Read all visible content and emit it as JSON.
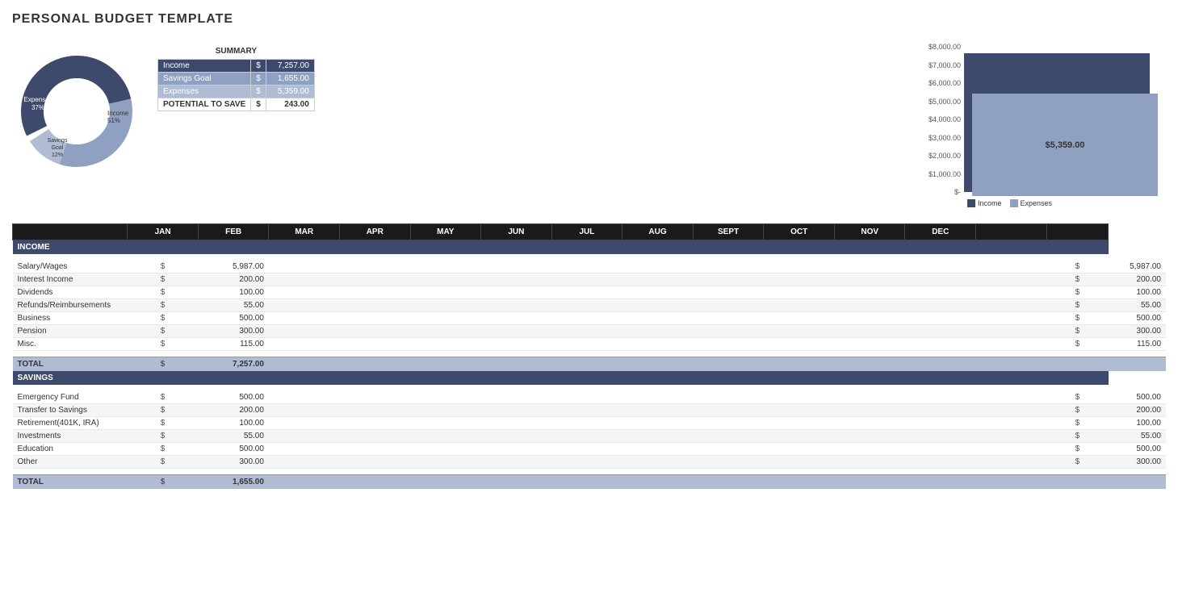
{
  "title": "PERSONAL BUDGET TEMPLATE",
  "summary": {
    "title": "SUMMARY",
    "rows": [
      {
        "label": "Income",
        "dollar": "$",
        "value": "7,257.00",
        "type": "income"
      },
      {
        "label": "Savings Goal",
        "dollar": "$",
        "value": "1,655.00",
        "type": "savings"
      },
      {
        "label": "Expenses",
        "dollar": "$",
        "value": "5,359.00",
        "type": "expenses"
      }
    ],
    "potential_label": "POTENTIAL TO SAVE",
    "potential_dollar": "$",
    "potential_value": "243.00"
  },
  "donut": {
    "income_pct": "51%",
    "income_label": "Income",
    "savings_pct": "12%",
    "savings_label": "Savings Goal",
    "expenses_pct": "37%",
    "expenses_label": "Expenses"
  },
  "chart": {
    "y_labels": [
      "$8,000.00",
      "$7,000.00",
      "$6,000.00",
      "$5,000.00",
      "$4,000.00",
      "$3,000.00",
      "$2,000.00",
      "$1,000.00",
      "$-"
    ],
    "income_value": "$7,257.00",
    "expenses_value": "$5,359.00",
    "legend_income": "Income",
    "legend_expenses": "Expenses"
  },
  "months": [
    "JAN",
    "FEB",
    "MAR",
    "APR",
    "MAY",
    "JUN",
    "JUL",
    "AUG",
    "SEPT",
    "OCT",
    "NOV",
    "DEC"
  ],
  "income": {
    "section_label": "INCOME",
    "rows": [
      {
        "label": "Salary/Wages",
        "dollar": "$",
        "jan": "5,987.00",
        "annual_dollar": "$",
        "annual": "5,987.00"
      },
      {
        "label": "Interest Income",
        "dollar": "$",
        "jan": "200.00",
        "annual_dollar": "$",
        "annual": "200.00"
      },
      {
        "label": "Dividends",
        "dollar": "$",
        "jan": "100.00",
        "annual_dollar": "$",
        "annual": "100.00"
      },
      {
        "label": "Refunds/Reimbursements",
        "dollar": "$",
        "jan": "55.00",
        "annual_dollar": "$",
        "annual": "55.00"
      },
      {
        "label": "Business",
        "dollar": "$",
        "jan": "500.00",
        "annual_dollar": "$",
        "annual": "500.00"
      },
      {
        "label": "Pension",
        "dollar": "$",
        "jan": "300.00",
        "annual_dollar": "$",
        "annual": "300.00"
      },
      {
        "label": "Misc.",
        "dollar": "$",
        "jan": "115.00",
        "annual_dollar": "$",
        "annual": "115.00"
      }
    ],
    "total_label": "TOTAL",
    "total_dollar": "$",
    "total_jan": "7,257.00"
  },
  "savings": {
    "section_label": "SAVINGS",
    "rows": [
      {
        "label": "Emergency Fund",
        "dollar": "$",
        "jan": "500.00",
        "annual_dollar": "$",
        "annual": "500.00"
      },
      {
        "label": "Transfer to Savings",
        "dollar": "$",
        "jan": "200.00",
        "annual_dollar": "$",
        "annual": "200.00"
      },
      {
        "label": "Retirement(401K, IRA)",
        "dollar": "$",
        "jan": "100.00",
        "annual_dollar": "$",
        "annual": "100.00"
      },
      {
        "label": "Investments",
        "dollar": "$",
        "jan": "55.00",
        "annual_dollar": "$",
        "annual": "55.00"
      },
      {
        "label": "Education",
        "dollar": "$",
        "jan": "500.00",
        "annual_dollar": "$",
        "annual": "500.00"
      },
      {
        "label": "Other",
        "dollar": "$",
        "jan": "300.00",
        "annual_dollar": "$",
        "annual": "300.00"
      }
    ],
    "total_label": "TOTAL",
    "total_dollar": "$",
    "total_jan": "1,655.00"
  }
}
